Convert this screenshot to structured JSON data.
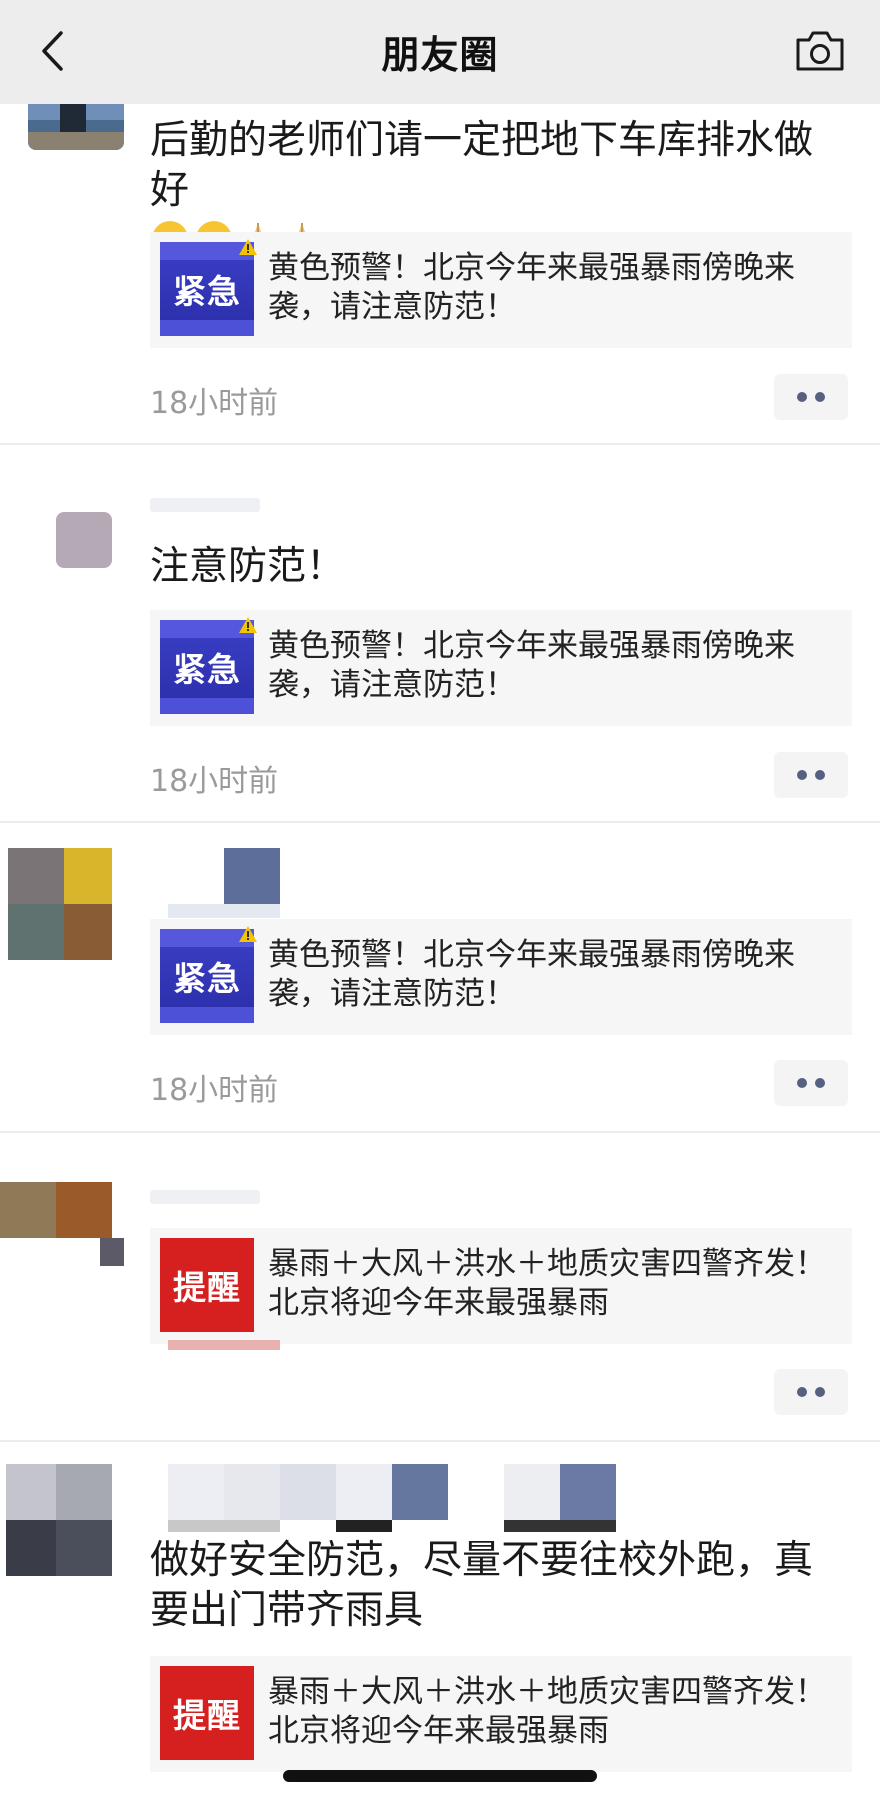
{
  "header": {
    "title": "朋友圈",
    "back_icon": "chevron-left-icon",
    "camera_icon": "camera-icon"
  },
  "posts": [
    {
      "text": "后勤的老师们请一定把地下车库排水做好",
      "emojis": [
        "crying-face-emoji",
        "crying-face-emoji",
        "folded-hands-emoji",
        "folded-hands-emoji"
      ],
      "link": {
        "thumb_label": "紧急",
        "title": "黄色预警！北京今年来最强暴雨傍晚来袭，请注意防范！"
      },
      "time": "18小时前"
    },
    {
      "text": "注意防范！",
      "link": {
        "thumb_label": "紧急",
        "title": "黄色预警！北京今年来最强暴雨傍晚来袭，请注意防范！"
      },
      "time": "18小时前"
    },
    {
      "text": "",
      "link": {
        "thumb_label": "紧急",
        "title": "黄色预警！北京今年来最强暴雨傍晚来袭，请注意防范！"
      },
      "time": "18小时前"
    },
    {
      "text": "",
      "link": {
        "thumb_label": "提醒",
        "title": "暴雨＋大风＋洪水＋地质灾害四警齐发！北京将迎今年来最强暴雨"
      },
      "time": ""
    },
    {
      "text": "做好安全防范，尽量不要往校外跑，真要出门带齐雨具",
      "link": {
        "thumb_label": "提醒",
        "title": "暴雨＋大风＋洪水＋地质灾害四警齐发！北京将迎今年来最强暴雨"
      },
      "time": ""
    }
  ],
  "colors": {
    "header_bg": "#ededed",
    "card_bg": "#f6f6f6",
    "urgent_thumb": "#2e32b0",
    "remind_thumb": "#d62020",
    "more_dots": "#56607f"
  }
}
